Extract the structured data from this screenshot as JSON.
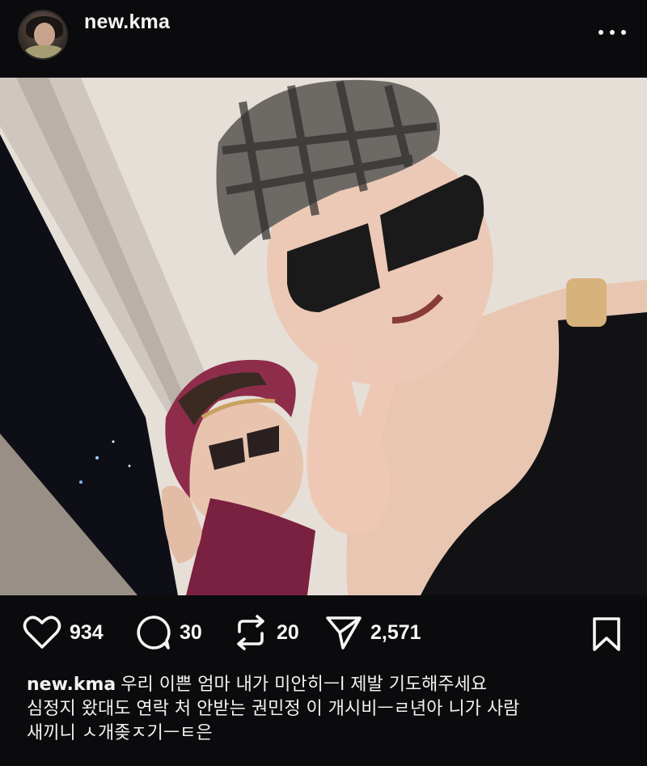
{
  "post": {
    "username": "new.kma",
    "likes": "934",
    "comments": "30",
    "reposts": "20",
    "shares": "2,571"
  },
  "caption": {
    "username": "new.kma",
    "line1": "우리 이쁜 엄마 내가 미안히ㅡl 제발 기도해주세요",
    "line2": "심정지 왔대도 연락 처 안받는 권민정 이 개시비ㅡㄹ년아 니가 사람",
    "line3": "새끼니 ㅅ개좆ㅈ기ㅡㅌ은"
  },
  "icons": {
    "more": "more-dots-icon",
    "like": "heart-icon",
    "comment": "comment-bubble-icon",
    "repost": "repost-icon",
    "share": "send-icon",
    "save": "bookmark-icon"
  },
  "colors": {
    "background": "#0b0b0d",
    "text": "#f5f5f5"
  }
}
